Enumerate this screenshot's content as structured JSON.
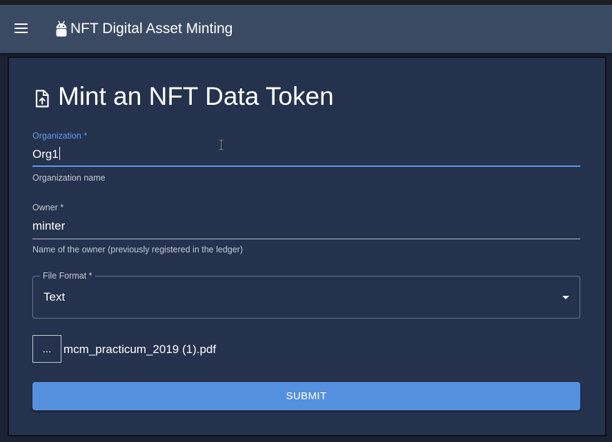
{
  "app": {
    "title": "NFT Digital Asset Minting",
    "menu_icon": "menu-icon",
    "logo_icon": "android-icon"
  },
  "form": {
    "title": "Mint an NFT Data Token",
    "title_icon": "upload-file-icon",
    "organization": {
      "label": "Organization *",
      "value": "Org1",
      "helper": "Organization name"
    },
    "owner": {
      "label": "Owner *",
      "value": "minter",
      "helper": "Name of the owner (previously registered in the ledger)"
    },
    "file_format": {
      "label": "File Format *",
      "value": "Text"
    },
    "file": {
      "button_label": "...",
      "file_name": "mcm_practicum_2019 (1).pdf"
    },
    "submit_label": "SUBMIT"
  },
  "colors": {
    "appbar": "#3b4a63",
    "card": "#25324d",
    "accent": "#5b9dec",
    "submit": "#5590de"
  }
}
